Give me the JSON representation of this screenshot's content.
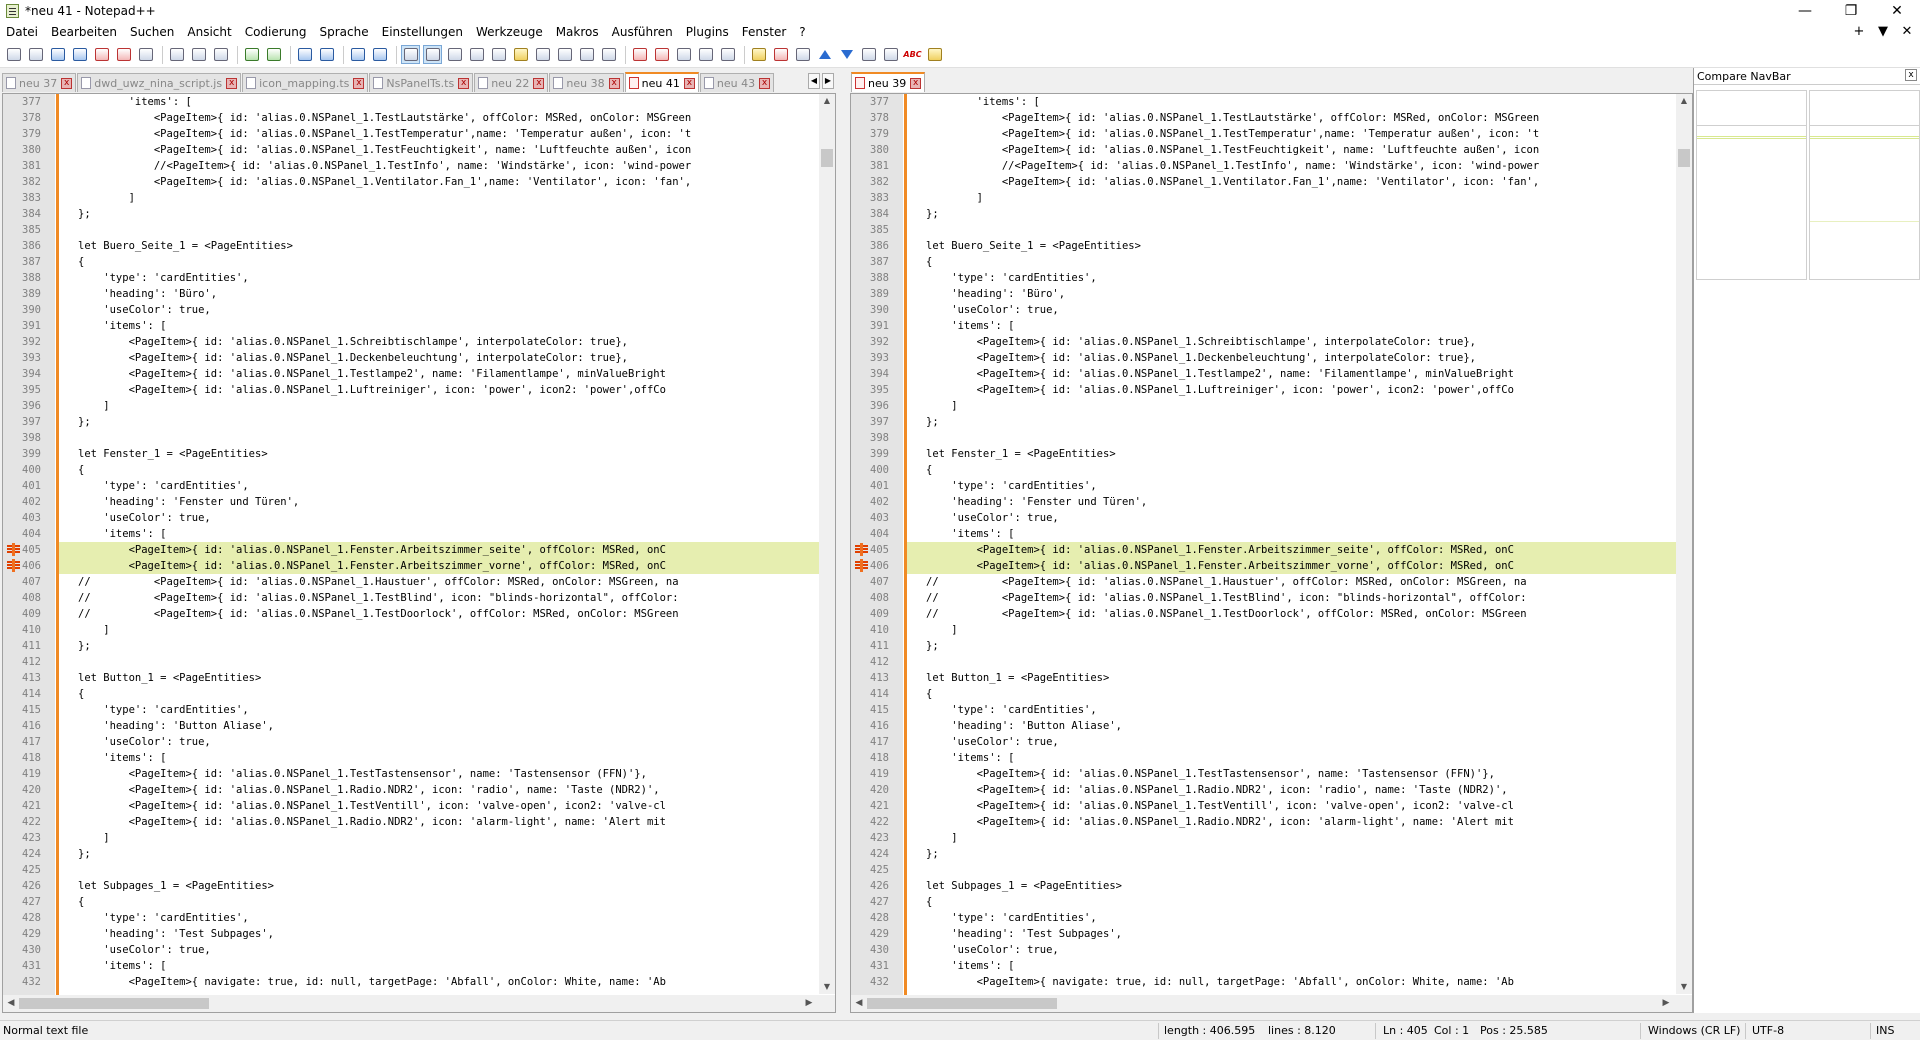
{
  "window": {
    "title": "*neu 41 - Notepad++",
    "minimize": "—",
    "maximize": "❐",
    "close": "✕"
  },
  "menu": [
    "Datei",
    "Bearbeiten",
    "Suchen",
    "Ansicht",
    "Codierung",
    "Sprache",
    "Einstellungen",
    "Werkzeuge",
    "Makros",
    "Ausführen",
    "Plugins",
    "Fenster",
    "?"
  ],
  "menu_right": {
    "plus": "+",
    "dropdown": "▼",
    "close": "✕"
  },
  "left_tabs": [
    {
      "label": "neu 37",
      "active": false
    },
    {
      "label": "dwd_uwz_nina_script.js",
      "active": false
    },
    {
      "label": "icon_mapping.ts",
      "active": false
    },
    {
      "label": "NsPanelTs.ts",
      "active": false
    },
    {
      "label": "neu 22",
      "active": false
    },
    {
      "label": "neu 38",
      "active": false
    },
    {
      "label": "neu 41",
      "active": true
    },
    {
      "label": "neu 43",
      "active": false
    }
  ],
  "right_tabs": [
    {
      "label": "neu 39",
      "active": true
    }
  ],
  "tab_close": "x",
  "code_lines": [
    {
      "n": "377",
      "t": "        'items': ["
    },
    {
      "n": "378",
      "t": "            <PageItem>{ id: 'alias.0.NSPanel_1.TestLautstärke', offColor: MSRed, onColor: MSGreen"
    },
    {
      "n": "379",
      "t": "            <PageItem>{ id: 'alias.0.NSPanel_1.TestTemperatur',name: 'Temperatur außen', icon: 't"
    },
    {
      "n": "380",
      "t": "            <PageItem>{ id: 'alias.0.NSPanel_1.TestFeuchtigkeit', name: 'Luftfeuchte außen', icon"
    },
    {
      "n": "381",
      "t": "            //<PageItem>{ id: 'alias.0.NSPanel_1.TestInfo', name: 'Windstärke', icon: 'wind-power"
    },
    {
      "n": "382",
      "t": "            <PageItem>{ id: 'alias.0.NSPanel_1.Ventilator.Fan_1',name: 'Ventilator', icon: 'fan',"
    },
    {
      "n": "383",
      "t": "        ]"
    },
    {
      "n": "384",
      "t": "};"
    },
    {
      "n": "385",
      "t": ""
    },
    {
      "n": "386",
      "t": "let Buero_Seite_1 = <PageEntities>"
    },
    {
      "n": "387",
      "t": "{"
    },
    {
      "n": "388",
      "t": "    'type': 'cardEntities',"
    },
    {
      "n": "389",
      "t": "    'heading': 'Büro',"
    },
    {
      "n": "390",
      "t": "    'useColor': true,"
    },
    {
      "n": "391",
      "t": "    'items': ["
    },
    {
      "n": "392",
      "t": "        <PageItem>{ id: 'alias.0.NSPanel_1.Schreibtischlampe', interpolateColor: true},"
    },
    {
      "n": "393",
      "t": "        <PageItem>{ id: 'alias.0.NSPanel_1.Deckenbeleuchtung', interpolateColor: true},"
    },
    {
      "n": "394",
      "t": "        <PageItem>{ id: 'alias.0.NSPanel_1.Testlampe2', name: 'Filamentlampe', minValueBright"
    },
    {
      "n": "395",
      "t": "        <PageItem>{ id: 'alias.0.NSPanel_1.Luftreiniger', icon: 'power', icon2: 'power',offCo"
    },
    {
      "n": "396",
      "t": "    ]"
    },
    {
      "n": "397",
      "t": "};"
    },
    {
      "n": "398",
      "t": ""
    },
    {
      "n": "399",
      "t": "let Fenster_1 = <PageEntities>"
    },
    {
      "n": "400",
      "t": "{"
    },
    {
      "n": "401",
      "t": "    'type': 'cardEntities',"
    },
    {
      "n": "402",
      "t": "    'heading': 'Fenster und Türen',"
    },
    {
      "n": "403",
      "t": "    'useColor': true,"
    },
    {
      "n": "404",
      "t": "    'items': ["
    },
    {
      "n": "405",
      "t": "        <PageItem>{ id: 'alias.0.NSPanel_1.Fenster.Arbeitszimmer_seite', offColor: MSRed, onC",
      "diff": true
    },
    {
      "n": "406",
      "t": "        <PageItem>{ id: 'alias.0.NSPanel_1.Fenster.Arbeitszimmer_vorne', offColor: MSRed, onC",
      "diff": true
    },
    {
      "n": "407",
      "t": "//          <PageItem>{ id: 'alias.0.NSPanel_1.Haustuer', offColor: MSRed, onColor: MSGreen, na"
    },
    {
      "n": "408",
      "t": "//          <PageItem>{ id: 'alias.0.NSPanel_1.TestBlind', icon: \"blinds-horizontal\", offColor:"
    },
    {
      "n": "409",
      "t": "//          <PageItem>{ id: 'alias.0.NSPanel_1.TestDoorlock', offColor: MSRed, onColor: MSGreen"
    },
    {
      "n": "410",
      "t": "    ]"
    },
    {
      "n": "411",
      "t": "};"
    },
    {
      "n": "412",
      "t": ""
    },
    {
      "n": "413",
      "t": "let Button_1 = <PageEntities>"
    },
    {
      "n": "414",
      "t": "{"
    },
    {
      "n": "415",
      "t": "    'type': 'cardEntities',"
    },
    {
      "n": "416",
      "t": "    'heading': 'Button Aliase',"
    },
    {
      "n": "417",
      "t": "    'useColor': true,"
    },
    {
      "n": "418",
      "t": "    'items': ["
    },
    {
      "n": "419",
      "t": "        <PageItem>{ id: 'alias.0.NSPanel_1.TestTastensensor', name: 'Tastensensor (FFN)'},"
    },
    {
      "n": "420",
      "t": "        <PageItem>{ id: 'alias.0.NSPanel_1.Radio.NDR2', icon: 'radio', name: 'Taste (NDR2)',"
    },
    {
      "n": "421",
      "t": "        <PageItem>{ id: 'alias.0.NSPanel_1.TestVentill', icon: 'valve-open', icon2: 'valve-cl"
    },
    {
      "n": "422",
      "t": "        <PageItem>{ id: 'alias.0.NSPanel_1.Radio.NDR2', icon: 'alarm-light', name: 'Alert mit"
    },
    {
      "n": "423",
      "t": "    ]"
    },
    {
      "n": "424",
      "t": "};"
    },
    {
      "n": "425",
      "t": ""
    },
    {
      "n": "426",
      "t": "let Subpages_1 = <PageEntities>"
    },
    {
      "n": "427",
      "t": "{"
    },
    {
      "n": "428",
      "t": "    'type': 'cardEntities',"
    },
    {
      "n": "429",
      "t": "    'heading': 'Test Subpages',"
    },
    {
      "n": "430",
      "t": "    'useColor': true,"
    },
    {
      "n": "431",
      "t": "    'items': ["
    },
    {
      "n": "432",
      "t": "        <PageItem>{ navigate: true, id: null, targetPage: 'Abfall', onColor: White, name: 'Ab"
    }
  ],
  "navbar": {
    "title": "Compare NavBar",
    "close": "x"
  },
  "status": {
    "type": "Normal text file",
    "length": "length : 406.595",
    "lines": "lines : 8.120",
    "ln": "Ln : 405",
    "col": "Col : 1",
    "pos": "Pos : 25.585",
    "eol": "Windows (CR LF)",
    "encoding": "UTF-8",
    "mode": "INS"
  },
  "colors": {
    "diff_bg": "#e6eeb0",
    "margin_orange": "#f08a24",
    "active_tab_accent": "#f08a24"
  }
}
